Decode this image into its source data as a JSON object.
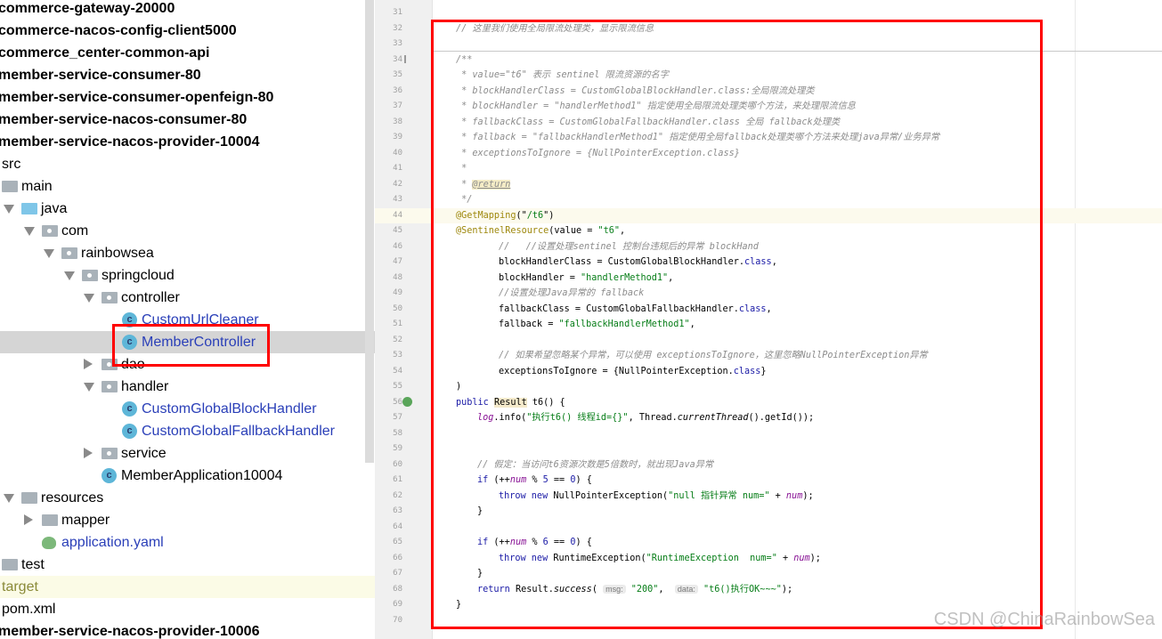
{
  "project_tree": {
    "items": [
      {
        "label": "commerce-gateway-20000",
        "level": 0,
        "type": "module",
        "bold": true
      },
      {
        "label": "commerce-nacos-config-client5000",
        "level": 0,
        "type": "module",
        "bold": true
      },
      {
        "label": "commerce_center-common-api",
        "level": 0,
        "type": "module",
        "bold": true
      },
      {
        "label": "member-service-consumer-80",
        "level": 0,
        "type": "module",
        "bold": true
      },
      {
        "label": "member-service-consumer-openfeign-80",
        "level": 0,
        "type": "module",
        "bold": true
      },
      {
        "label": "member-service-nacos-consumer-80",
        "level": 0,
        "type": "module",
        "bold": true
      },
      {
        "label": "member-service-nacos-provider-10004",
        "level": 0,
        "type": "module",
        "bold": true
      },
      {
        "label": "src",
        "level": 0,
        "type": "text"
      },
      {
        "label": "main",
        "level": 1,
        "type": "folder"
      },
      {
        "label": "java",
        "level": 2,
        "type": "src",
        "expanded": true
      },
      {
        "label": "com",
        "level": 3,
        "type": "package",
        "expanded": true
      },
      {
        "label": "rainbowsea",
        "level": 4,
        "type": "package",
        "expanded": true
      },
      {
        "label": "springcloud",
        "level": 5,
        "type": "package",
        "expanded": true
      },
      {
        "label": "controller",
        "level": 6,
        "type": "package",
        "expanded": true
      },
      {
        "label": "CustomUrlCleaner",
        "level": 7,
        "type": "class"
      },
      {
        "label": "MemberController",
        "level": 7,
        "type": "class",
        "selected": true
      },
      {
        "label": "dao",
        "level": 6,
        "type": "package",
        "expanded": false
      },
      {
        "label": "handler",
        "level": 6,
        "type": "package",
        "expanded": true
      },
      {
        "label": "CustomGlobalBlockHandler",
        "level": 7,
        "type": "class"
      },
      {
        "label": "CustomGlobalFallbackHandler",
        "level": 7,
        "type": "class"
      },
      {
        "label": "service",
        "level": 6,
        "type": "package",
        "expanded": false
      },
      {
        "label": "MemberApplication10004",
        "level": 6,
        "type": "appclass"
      },
      {
        "label": "resources",
        "level": 2,
        "type": "folder",
        "expanded": true
      },
      {
        "label": "mapper",
        "level": 3,
        "type": "folder",
        "expanded": false
      },
      {
        "label": "application.yaml",
        "level": 3,
        "type": "yaml"
      },
      {
        "label": "test",
        "level": 1,
        "type": "folder"
      },
      {
        "label": "target",
        "level": 0,
        "type": "target"
      },
      {
        "label": "pom.xml",
        "level": 0,
        "type": "text"
      },
      {
        "label": "member-service-nacos-provider-10006",
        "level": 0,
        "type": "module",
        "bold": true
      }
    ]
  },
  "editor": {
    "highlight_line": 44,
    "lines": [
      {
        "n": "31",
        "ind": 0,
        "t": []
      },
      {
        "n": "32",
        "ind": 0,
        "t": [
          {
            "c": "c",
            "v": "// 这里我们使用全局限流处理类，显示限流信息"
          }
        ]
      },
      {
        "n": "33",
        "ind": 0,
        "t": []
      },
      {
        "n": "34",
        "ind": 0,
        "t": [
          {
            "c": "c",
            "v": "/**"
          }
        ]
      },
      {
        "n": "35",
        "ind": 0,
        "t": [
          {
            "c": "c",
            "v": " * value=\"t6\" 表示 sentinel 限流资源的名字"
          }
        ]
      },
      {
        "n": "36",
        "ind": 0,
        "t": [
          {
            "c": "c",
            "v": " * blockHandlerClass = CustomGlobalBlockHandler.class:全局限流处理类"
          }
        ]
      },
      {
        "n": "37",
        "ind": 0,
        "t": [
          {
            "c": "c",
            "v": " * blockHandler = \"handlerMethod1\" 指定使用全局限流处理类哪个方法，来处理限流信息"
          }
        ]
      },
      {
        "n": "38",
        "ind": 0,
        "t": [
          {
            "c": "c",
            "v": " * fallbackClass = CustomGlobalFallbackHandler.class 全局 fallback处理类"
          }
        ]
      },
      {
        "n": "39",
        "ind": 0,
        "t": [
          {
            "c": "c",
            "v": " * fallback = \"fallbackHandlerMethod1\" 指定使用全局fallback处理类哪个方法来处理java异常/业务异常"
          }
        ]
      },
      {
        "n": "40",
        "ind": 0,
        "t": [
          {
            "c": "c",
            "v": " * exceptionsToIgnore = {NullPointerException.class}"
          }
        ]
      },
      {
        "n": "41",
        "ind": 0,
        "t": [
          {
            "c": "c",
            "v": " *"
          }
        ]
      },
      {
        "n": "42",
        "ind": 0,
        "t": [
          {
            "c": "c",
            "v": " * "
          },
          {
            "c": "tag",
            "v": "@return"
          }
        ]
      },
      {
        "n": "43",
        "ind": 0,
        "t": [
          {
            "c": "c",
            "v": " */"
          }
        ]
      },
      {
        "n": "44",
        "ind": 0,
        "t": [
          {
            "c": "a",
            "v": "@GetMapping"
          },
          {
            "c": "",
            "v": "(\""
          },
          {
            "c": "s",
            "v": "/t6"
          },
          {
            "c": "",
            "v": "\")"
          }
        ]
      },
      {
        "n": "45",
        "ind": 0,
        "t": [
          {
            "c": "a",
            "v": "@SentinelResource"
          },
          {
            "c": "",
            "v": "(value = "
          },
          {
            "c": "s",
            "v": "\"t6\""
          },
          {
            "c": "",
            "v": ","
          }
        ]
      },
      {
        "n": "46",
        "ind": 2,
        "t": [
          {
            "c": "c",
            "v": "//   //设置处理sentinel 控制台违规后的异常 blockHand"
          }
        ]
      },
      {
        "n": "47",
        "ind": 2,
        "t": [
          {
            "c": "",
            "v": "blockHandlerClass = CustomGlobalBlockHandler."
          },
          {
            "c": "k",
            "v": "class"
          },
          {
            "c": "",
            "v": ","
          }
        ]
      },
      {
        "n": "48",
        "ind": 2,
        "t": [
          {
            "c": "",
            "v": "blockHandler = "
          },
          {
            "c": "s",
            "v": "\"handlerMethod1\""
          },
          {
            "c": "",
            "v": ","
          }
        ]
      },
      {
        "n": "49",
        "ind": 2,
        "t": [
          {
            "c": "c",
            "v": "//设置处理Java异常的 fallback"
          }
        ]
      },
      {
        "n": "50",
        "ind": 2,
        "t": [
          {
            "c": "",
            "v": "fallbackClass = CustomGlobalFallbackHandler."
          },
          {
            "c": "k",
            "v": "class"
          },
          {
            "c": "",
            "v": ","
          }
        ]
      },
      {
        "n": "51",
        "ind": 2,
        "t": [
          {
            "c": "",
            "v": "fallback = "
          },
          {
            "c": "s",
            "v": "\"fallbackHandlerMethod1\""
          },
          {
            "c": "",
            "v": ","
          }
        ]
      },
      {
        "n": "52",
        "ind": 0,
        "t": []
      },
      {
        "n": "53",
        "ind": 2,
        "t": [
          {
            "c": "c",
            "v": "// 如果希望忽略某个异常，可以使用 exceptionsToIgnore，这里忽略NullPointerException异常"
          }
        ]
      },
      {
        "n": "54",
        "ind": 2,
        "t": [
          {
            "c": "",
            "v": "exceptionsToIgnore = {NullPointerException."
          },
          {
            "c": "k",
            "v": "class"
          },
          {
            "c": "",
            "v": "}"
          }
        ]
      },
      {
        "n": "55",
        "ind": 0,
        "t": [
          {
            "c": "",
            "v": ")"
          }
        ]
      },
      {
        "n": "56",
        "ind": 0,
        "t": [
          {
            "c": "k",
            "v": "public "
          },
          {
            "c": "hlres",
            "v": "Result"
          },
          {
            "c": "",
            "v": " t6() {"
          }
        ]
      },
      {
        "n": "57",
        "ind": 1,
        "t": [
          {
            "c": "f",
            "v": "log"
          },
          {
            "c": "",
            "v": ".info("
          },
          {
            "c": "s",
            "v": "\"执行t6() 线程id={}\""
          },
          {
            "c": "",
            "v": ", Thread."
          },
          {
            "c": "i",
            "v": "currentThread"
          },
          {
            "c": "",
            "v": "().getId());"
          }
        ]
      },
      {
        "n": "58",
        "ind": 0,
        "t": []
      },
      {
        "n": "59",
        "ind": 0,
        "t": []
      },
      {
        "n": "60",
        "ind": 1,
        "t": [
          {
            "c": "c",
            "v": "// 假定：当访问t6资源次数是5倍数时，就出现Java异常"
          }
        ]
      },
      {
        "n": "61",
        "ind": 1,
        "t": [
          {
            "c": "k",
            "v": "if "
          },
          {
            "c": "",
            "v": "(++"
          },
          {
            "c": "f",
            "v": "num"
          },
          {
            "c": "",
            "v": " % "
          },
          {
            "c": "k",
            "v": "5"
          },
          {
            "c": "",
            "v": " == "
          },
          {
            "c": "k",
            "v": "0"
          },
          {
            "c": "",
            "v": ") {"
          }
        ]
      },
      {
        "n": "62",
        "ind": 2,
        "t": [
          {
            "c": "k",
            "v": "throw new "
          },
          {
            "c": "",
            "v": "NullPointerException("
          },
          {
            "c": "s",
            "v": "\"null 指针异常 num=\""
          },
          {
            "c": "",
            "v": " + "
          },
          {
            "c": "f",
            "v": "num"
          },
          {
            "c": "",
            "v": ");"
          }
        ]
      },
      {
        "n": "63",
        "ind": 1,
        "t": [
          {
            "c": "",
            "v": "}"
          }
        ]
      },
      {
        "n": "64",
        "ind": 0,
        "t": []
      },
      {
        "n": "65",
        "ind": 1,
        "t": [
          {
            "c": "k",
            "v": "if "
          },
          {
            "c": "",
            "v": "(++"
          },
          {
            "c": "f",
            "v": "num"
          },
          {
            "c": "",
            "v": " % "
          },
          {
            "c": "k",
            "v": "6"
          },
          {
            "c": "",
            "v": " == "
          },
          {
            "c": "k",
            "v": "0"
          },
          {
            "c": "",
            "v": ") {"
          }
        ]
      },
      {
        "n": "66",
        "ind": 2,
        "t": [
          {
            "c": "k",
            "v": "throw new "
          },
          {
            "c": "",
            "v": "RuntimeException("
          },
          {
            "c": "s",
            "v": "\"RuntimeException  num=\""
          },
          {
            "c": "",
            "v": " + "
          },
          {
            "c": "f",
            "v": "num"
          },
          {
            "c": "",
            "v": ");"
          }
        ]
      },
      {
        "n": "67",
        "ind": 1,
        "t": [
          {
            "c": "",
            "v": "}"
          }
        ]
      },
      {
        "n": "68",
        "ind": 1,
        "t": [
          {
            "c": "k",
            "v": "return "
          },
          {
            "c": "",
            "v": "Result."
          },
          {
            "c": "i",
            "v": "success"
          },
          {
            "c": "",
            "v": "( "
          },
          {
            "c": "hint",
            "v": "msg:"
          },
          {
            "c": "",
            "v": " "
          },
          {
            "c": "s",
            "v": "\"200\""
          },
          {
            "c": "",
            "v": ",  "
          },
          {
            "c": "hint",
            "v": "data:"
          },
          {
            "c": "",
            "v": " "
          },
          {
            "c": "s",
            "v": "\"t6()执行OK~~~\""
          },
          {
            "c": "",
            "v": ");"
          }
        ]
      },
      {
        "n": "69",
        "ind": 0,
        "t": [
          {
            "c": "",
            "v": "}"
          }
        ]
      },
      {
        "n": "70",
        "ind": 0,
        "t": []
      }
    ]
  },
  "watermark": "CSDN @ChinaRainbowSea",
  "colors": {
    "annotation_box": "#ff0000",
    "selection": "#d5d5d5"
  }
}
